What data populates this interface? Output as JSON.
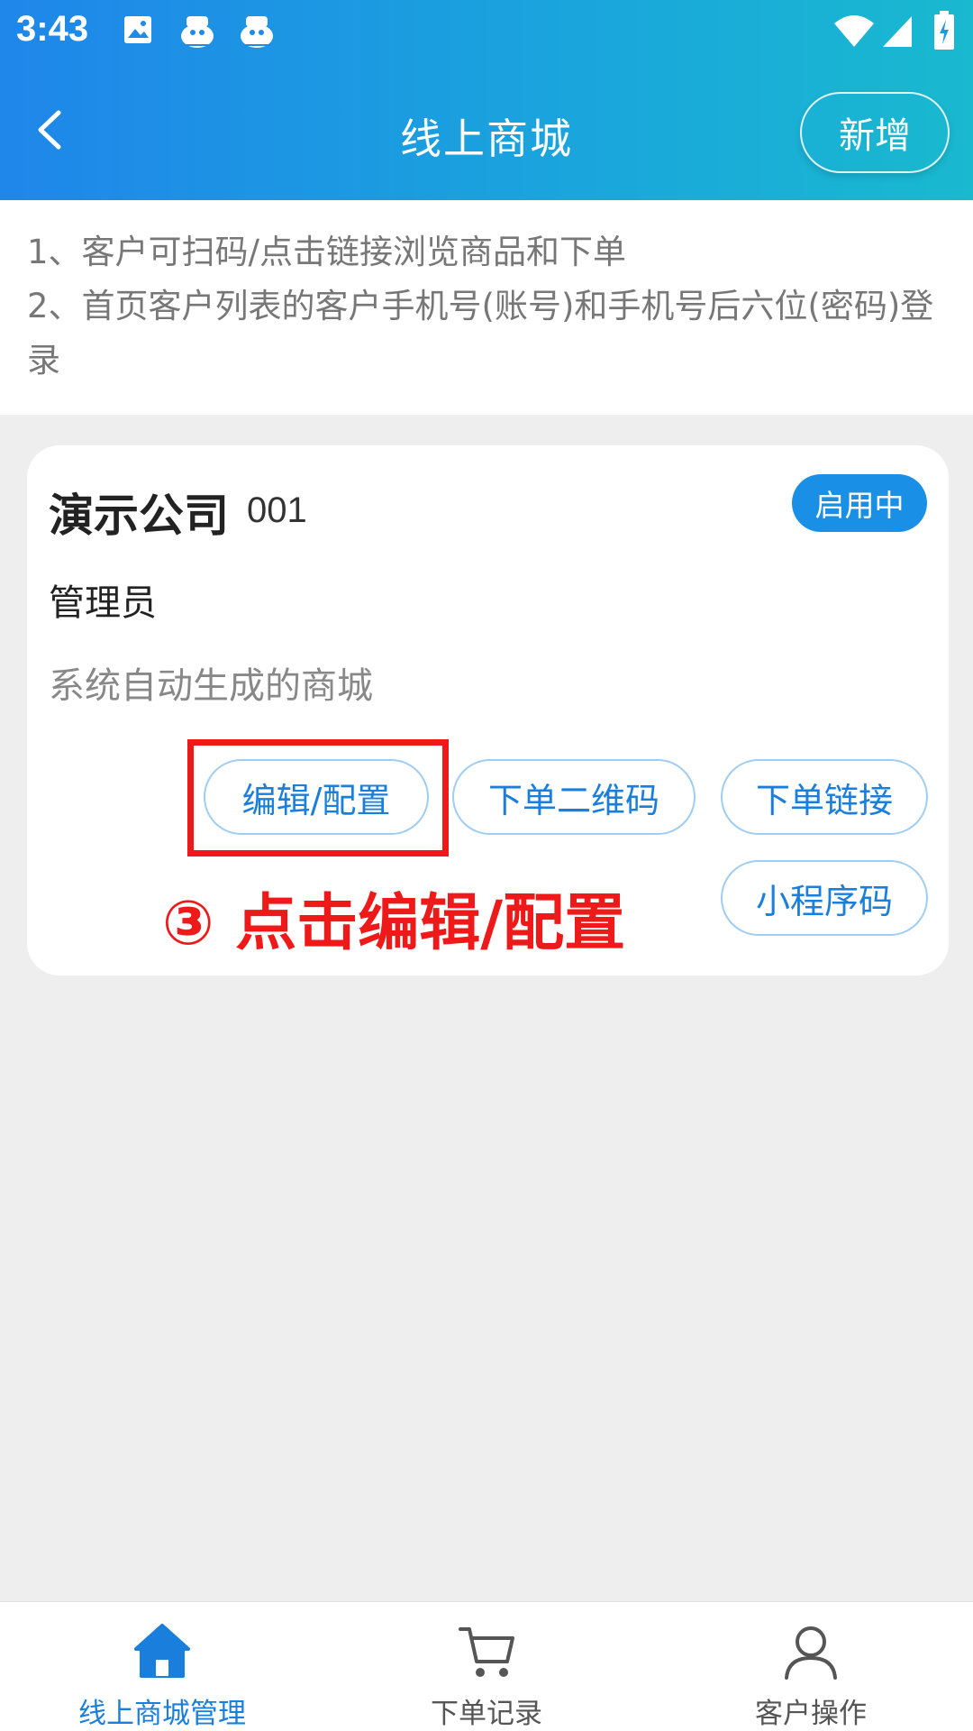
{
  "status_bar": {
    "time": "3:43"
  },
  "nav": {
    "title": "线上商城",
    "add_label": "新增"
  },
  "notice": {
    "line1": "1、客户可扫码/点击链接浏览商品和下单",
    "line2": "2、首页客户列表的客户手机号(账号)和手机号后六位(密码)登录"
  },
  "card": {
    "title": "演示公司",
    "code": "001",
    "status": "启用中",
    "manager": "管理员",
    "description": "系统自动生成的商城",
    "actions": {
      "edit": "编辑/配置",
      "qrcode": "下单二维码",
      "link": "下单链接",
      "miniprogram": "小程序码"
    }
  },
  "annotation": {
    "text": "③ 点击编辑/配置"
  },
  "tabs": [
    {
      "label": "线上商城管理",
      "icon": "home-icon",
      "active": true
    },
    {
      "label": "下单记录",
      "icon": "cart-icon",
      "active": false
    },
    {
      "label": "客户操作",
      "icon": "user-icon",
      "active": false
    }
  ],
  "colors": {
    "primary": "#1a7fdc",
    "badge": "#1a8fe6",
    "annotation": "#ee1a1a"
  }
}
